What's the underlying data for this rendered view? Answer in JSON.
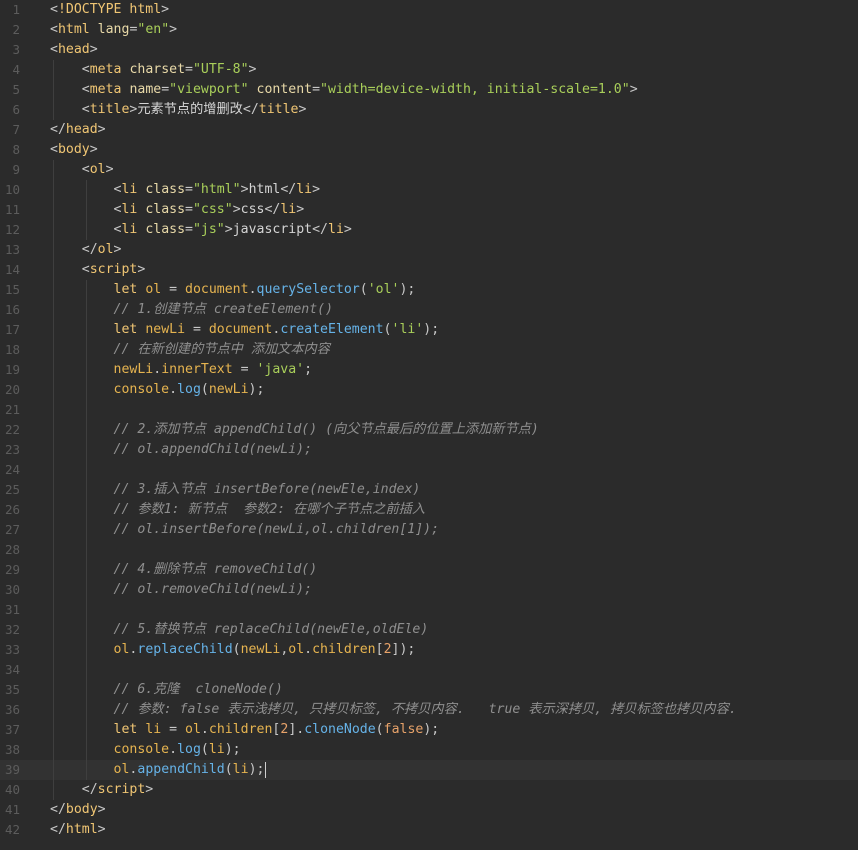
{
  "colors": {
    "background": "#2b2b2b",
    "tag": "#f0c674",
    "string": "#a9cf5a",
    "function": "#66b3e8",
    "comment": "#8f8f8f",
    "number": "#e8a36a"
  },
  "cursor_line": 39,
  "lines": [
    {
      "n": "1",
      "t": [
        [
          "pun",
          "<"
        ],
        [
          "tag",
          "!DOCTYPE html"
        ],
        [
          "pun",
          ">"
        ]
      ]
    },
    {
      "n": "2",
      "t": [
        [
          "pun",
          "<"
        ],
        [
          "tag",
          "html"
        ],
        [
          "txt",
          " "
        ],
        [
          "attr",
          "lang"
        ],
        [
          "pun",
          "="
        ],
        [
          "str",
          "\"en\""
        ],
        [
          "pun",
          ">"
        ]
      ]
    },
    {
      "n": "3",
      "t": [
        [
          "pun",
          "<"
        ],
        [
          "tag",
          "head"
        ],
        [
          "pun",
          ">"
        ]
      ]
    },
    {
      "n": "4",
      "t": [
        [
          "txt",
          "    "
        ],
        [
          "pun",
          "<"
        ],
        [
          "tag",
          "meta"
        ],
        [
          "txt",
          " "
        ],
        [
          "attr",
          "charset"
        ],
        [
          "pun",
          "="
        ],
        [
          "str",
          "\"UTF-8\""
        ],
        [
          "pun",
          ">"
        ]
      ]
    },
    {
      "n": "5",
      "t": [
        [
          "txt",
          "    "
        ],
        [
          "pun",
          "<"
        ],
        [
          "tag",
          "meta"
        ],
        [
          "txt",
          " "
        ],
        [
          "attr",
          "name"
        ],
        [
          "pun",
          "="
        ],
        [
          "str",
          "\"viewport\""
        ],
        [
          "txt",
          " "
        ],
        [
          "attr",
          "content"
        ],
        [
          "pun",
          "="
        ],
        [
          "str",
          "\"width=device-width, initial-scale=1.0\""
        ],
        [
          "pun",
          ">"
        ]
      ]
    },
    {
      "n": "6",
      "t": [
        [
          "txt",
          "    "
        ],
        [
          "pun",
          "<"
        ],
        [
          "tag",
          "title"
        ],
        [
          "pun",
          ">"
        ],
        [
          "txt",
          "元素节点的增删改"
        ],
        [
          "pun",
          "</"
        ],
        [
          "tag",
          "title"
        ],
        [
          "pun",
          ">"
        ]
      ]
    },
    {
      "n": "7",
      "t": [
        [
          "pun",
          "</"
        ],
        [
          "tag",
          "head"
        ],
        [
          "pun",
          ">"
        ]
      ]
    },
    {
      "n": "8",
      "t": [
        [
          "pun",
          "<"
        ],
        [
          "tag",
          "body"
        ],
        [
          "pun",
          ">"
        ]
      ]
    },
    {
      "n": "9",
      "t": [
        [
          "txt",
          "    "
        ],
        [
          "pun",
          "<"
        ],
        [
          "tag",
          "ol"
        ],
        [
          "pun",
          ">"
        ]
      ]
    },
    {
      "n": "10",
      "t": [
        [
          "txt",
          "        "
        ],
        [
          "pun",
          "<"
        ],
        [
          "tag",
          "li"
        ],
        [
          "txt",
          " "
        ],
        [
          "attr",
          "class"
        ],
        [
          "pun",
          "="
        ],
        [
          "str",
          "\"html\""
        ],
        [
          "pun",
          ">"
        ],
        [
          "txt",
          "html"
        ],
        [
          "pun",
          "</"
        ],
        [
          "tag",
          "li"
        ],
        [
          "pun",
          ">"
        ]
      ]
    },
    {
      "n": "11",
      "t": [
        [
          "txt",
          "        "
        ],
        [
          "pun",
          "<"
        ],
        [
          "tag",
          "li"
        ],
        [
          "txt",
          " "
        ],
        [
          "attr",
          "class"
        ],
        [
          "pun",
          "="
        ],
        [
          "str",
          "\"css\""
        ],
        [
          "pun",
          ">"
        ],
        [
          "txt",
          "css"
        ],
        [
          "pun",
          "</"
        ],
        [
          "tag",
          "li"
        ],
        [
          "pun",
          ">"
        ]
      ]
    },
    {
      "n": "12",
      "t": [
        [
          "txt",
          "        "
        ],
        [
          "pun",
          "<"
        ],
        [
          "tag",
          "li"
        ],
        [
          "txt",
          " "
        ],
        [
          "attr",
          "class"
        ],
        [
          "pun",
          "="
        ],
        [
          "str",
          "\"js\""
        ],
        [
          "pun",
          ">"
        ],
        [
          "txt",
          "javascript"
        ],
        [
          "pun",
          "</"
        ],
        [
          "tag",
          "li"
        ],
        [
          "pun",
          ">"
        ]
      ]
    },
    {
      "n": "13",
      "t": [
        [
          "txt",
          "    "
        ],
        [
          "pun",
          "</"
        ],
        [
          "tag",
          "ol"
        ],
        [
          "pun",
          ">"
        ]
      ]
    },
    {
      "n": "14",
      "t": [
        [
          "txt",
          "    "
        ],
        [
          "pun",
          "<"
        ],
        [
          "tag",
          "script"
        ],
        [
          "pun",
          ">"
        ]
      ]
    },
    {
      "n": "15",
      "t": [
        [
          "txt",
          "        "
        ],
        [
          "kw",
          "let"
        ],
        [
          "txt",
          " "
        ],
        [
          "var",
          "ol"
        ],
        [
          "pun",
          " = "
        ],
        [
          "var",
          "document"
        ],
        [
          "pun",
          "."
        ],
        [
          "fn",
          "querySelector"
        ],
        [
          "pun",
          "("
        ],
        [
          "str",
          "'ol'"
        ],
        [
          "pun",
          ");"
        ]
      ]
    },
    {
      "n": "16",
      "t": [
        [
          "txt",
          "        "
        ],
        [
          "com",
          "// 1.创建节点 createElement()"
        ]
      ]
    },
    {
      "n": "17",
      "t": [
        [
          "txt",
          "        "
        ],
        [
          "kw",
          "let"
        ],
        [
          "txt",
          " "
        ],
        [
          "var",
          "newLi"
        ],
        [
          "pun",
          " = "
        ],
        [
          "var",
          "document"
        ],
        [
          "pun",
          "."
        ],
        [
          "fn",
          "createElement"
        ],
        [
          "pun",
          "("
        ],
        [
          "str",
          "'li'"
        ],
        [
          "pun",
          ");"
        ]
      ]
    },
    {
      "n": "18",
      "t": [
        [
          "txt",
          "        "
        ],
        [
          "com",
          "// 在新创建的节点中 添加文本内容"
        ]
      ]
    },
    {
      "n": "19",
      "t": [
        [
          "txt",
          "        "
        ],
        [
          "var",
          "newLi"
        ],
        [
          "pun",
          "."
        ],
        [
          "var",
          "innerText"
        ],
        [
          "pun",
          " = "
        ],
        [
          "str",
          "'java'"
        ],
        [
          "pun",
          ";"
        ]
      ]
    },
    {
      "n": "20",
      "t": [
        [
          "txt",
          "        "
        ],
        [
          "var",
          "console"
        ],
        [
          "pun",
          "."
        ],
        [
          "fn",
          "log"
        ],
        [
          "pun",
          "("
        ],
        [
          "var",
          "newLi"
        ],
        [
          "pun",
          ");"
        ]
      ]
    },
    {
      "n": "21",
      "t": []
    },
    {
      "n": "22",
      "t": [
        [
          "txt",
          "        "
        ],
        [
          "com",
          "// 2.添加节点 appendChild() (向父节点最后的位置上添加新节点)"
        ]
      ]
    },
    {
      "n": "23",
      "t": [
        [
          "txt",
          "        "
        ],
        [
          "com",
          "// ol.appendChild(newLi);"
        ]
      ]
    },
    {
      "n": "24",
      "t": []
    },
    {
      "n": "25",
      "t": [
        [
          "txt",
          "        "
        ],
        [
          "com",
          "// 3.插入节点 insertBefore(newEle,index)"
        ]
      ]
    },
    {
      "n": "26",
      "t": [
        [
          "txt",
          "        "
        ],
        [
          "com",
          "// 参数1: 新节点  参数2: 在哪个子节点之前插入"
        ]
      ]
    },
    {
      "n": "27",
      "t": [
        [
          "txt",
          "        "
        ],
        [
          "com",
          "// ol.insertBefore(newLi,ol.children[1]);"
        ]
      ]
    },
    {
      "n": "28",
      "t": []
    },
    {
      "n": "29",
      "t": [
        [
          "txt",
          "        "
        ],
        [
          "com",
          "// 4.删除节点 removeChild()"
        ]
      ]
    },
    {
      "n": "30",
      "t": [
        [
          "txt",
          "        "
        ],
        [
          "com",
          "// ol.removeChild(newLi);"
        ]
      ]
    },
    {
      "n": "31",
      "t": []
    },
    {
      "n": "32",
      "t": [
        [
          "txt",
          "        "
        ],
        [
          "com",
          "// 5.替换节点 replaceChild(newEle,oldEle)"
        ]
      ]
    },
    {
      "n": "33",
      "t": [
        [
          "txt",
          "        "
        ],
        [
          "var",
          "ol"
        ],
        [
          "pun",
          "."
        ],
        [
          "fn",
          "replaceChild"
        ],
        [
          "pun",
          "("
        ],
        [
          "var",
          "newLi"
        ],
        [
          "pun",
          ","
        ],
        [
          "var",
          "ol"
        ],
        [
          "pun",
          "."
        ],
        [
          "var",
          "children"
        ],
        [
          "pun",
          "["
        ],
        [
          "num",
          "2"
        ],
        [
          "pun",
          "]);"
        ]
      ]
    },
    {
      "n": "34",
      "t": []
    },
    {
      "n": "35",
      "t": [
        [
          "txt",
          "        "
        ],
        [
          "com",
          "// 6.克隆  cloneNode()"
        ]
      ]
    },
    {
      "n": "36",
      "t": [
        [
          "txt",
          "        "
        ],
        [
          "com",
          "// 参数: false 表示浅拷贝, 只拷贝标签, 不拷贝内容.   true 表示深拷贝, 拷贝标签也拷贝内容."
        ]
      ]
    },
    {
      "n": "37",
      "t": [
        [
          "txt",
          "        "
        ],
        [
          "kw",
          "let"
        ],
        [
          "txt",
          " "
        ],
        [
          "var",
          "li"
        ],
        [
          "pun",
          " = "
        ],
        [
          "var",
          "ol"
        ],
        [
          "pun",
          "."
        ],
        [
          "var",
          "children"
        ],
        [
          "pun",
          "["
        ],
        [
          "num",
          "2"
        ],
        [
          "pun",
          "]."
        ],
        [
          "fn",
          "cloneNode"
        ],
        [
          "pun",
          "("
        ],
        [
          "bool",
          "false"
        ],
        [
          "pun",
          ");"
        ]
      ]
    },
    {
      "n": "38",
      "t": [
        [
          "txt",
          "        "
        ],
        [
          "var",
          "console"
        ],
        [
          "pun",
          "."
        ],
        [
          "fn",
          "log"
        ],
        [
          "pun",
          "("
        ],
        [
          "var",
          "li"
        ],
        [
          "pun",
          ");"
        ]
      ]
    },
    {
      "n": "39",
      "t": [
        [
          "txt",
          "        "
        ],
        [
          "var",
          "ol"
        ],
        [
          "pun",
          "."
        ],
        [
          "fn",
          "appendChild"
        ],
        [
          "pun",
          "("
        ],
        [
          "var",
          "li"
        ],
        [
          "pun",
          ");"
        ]
      ]
    },
    {
      "n": "40",
      "t": [
        [
          "txt",
          "    "
        ],
        [
          "pun",
          "</"
        ],
        [
          "tag",
          "script"
        ],
        [
          "pun",
          ">"
        ]
      ]
    },
    {
      "n": "41",
      "t": [
        [
          "pun",
          "</"
        ],
        [
          "tag",
          "body"
        ],
        [
          "pun",
          ">"
        ]
      ]
    },
    {
      "n": "42",
      "t": [
        [
          "pun",
          "</"
        ],
        [
          "tag",
          "html"
        ],
        [
          "pun",
          ">"
        ]
      ]
    }
  ]
}
